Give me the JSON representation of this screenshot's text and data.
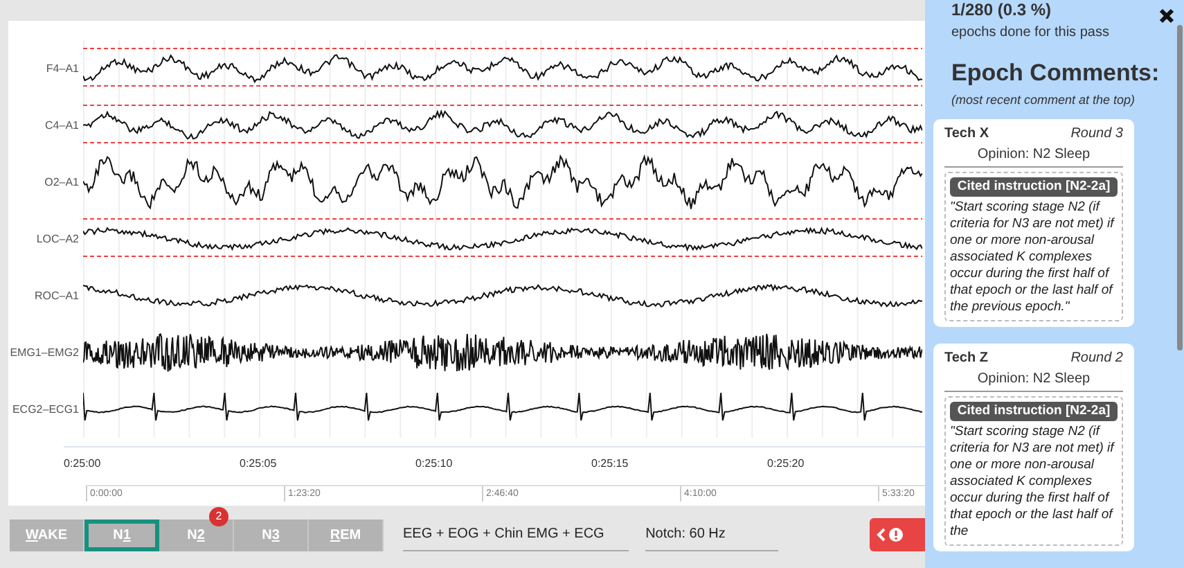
{
  "channels": [
    {
      "label": "F4–A1",
      "kind": "eeg",
      "threshold_lines": true
    },
    {
      "label": "C4–A1",
      "kind": "eeg",
      "threshold_lines": true
    },
    {
      "label": "O2–A1",
      "kind": "eeg_large",
      "threshold_lines": false
    },
    {
      "label": "LOC–A2",
      "kind": "eog",
      "threshold_lines": true
    },
    {
      "label": "ROC–A1",
      "kind": "eog",
      "threshold_lines": false
    },
    {
      "label": "EMG1–EMG2",
      "kind": "emg",
      "threshold_lines": false
    },
    {
      "label": "ECG2–ECG1",
      "kind": "ecg",
      "threshold_lines": false
    }
  ],
  "time_axis": [
    "0:25:00",
    "0:25:05",
    "0:25:10",
    "0:25:15",
    "0:25:20"
  ],
  "overview_axis": [
    "0:00:00",
    "1:23:20",
    "2:46:40",
    "4:10:00",
    "5:33:20"
  ],
  "stage_buttons": [
    {
      "key": "W",
      "after": "AKE",
      "selected": false
    },
    {
      "before": "N",
      "key": "1",
      "selected": true
    },
    {
      "before": "N",
      "key": "2",
      "selected": false,
      "badge": "2"
    },
    {
      "before": "N",
      "key": "3",
      "selected": false
    },
    {
      "key": "R",
      "after": "EM",
      "selected": false
    }
  ],
  "montage": "EEG + EOG + Chin EMG + ECG",
  "notch": "Notch: 60 Hz",
  "sidebar": {
    "progress": "1/280 (0.3 %)",
    "progress_caption": "epochs done for this pass",
    "heading": "Epoch Comments:",
    "subheading": "(most recent comment at the top)",
    "comments": [
      {
        "author": "Tech X",
        "round": "Round 3",
        "opinion": "Opinion: N2 Sleep",
        "citation": "Cited instruction [N2-2a]",
        "quote": "\"Start scoring stage N2 (if criteria for N3 are not met) if one or more non-arousal associated K complexes occur during the first half of that epoch or the last half of the previous epoch.\""
      },
      {
        "author": "Tech Z",
        "round": "Round 2",
        "opinion": "Opinion: N2 Sleep",
        "citation": "Cited instruction [N2-2a]",
        "quote": "\"Start scoring stage N2 (if criteria for N3 are not met) if one or more non-arousal associated K complexes occur during the first half of that epoch or the last half of the"
      }
    ]
  }
}
